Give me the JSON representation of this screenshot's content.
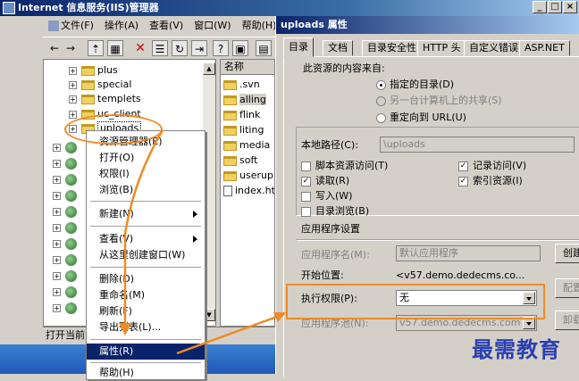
{
  "main_window": {
    "title": "Internet 信息服务(IIS)管理器",
    "controls": {
      "minimize": "_",
      "maximize": "□",
      "close": "×"
    }
  },
  "menubar": [
    "文件(F)",
    "操作(A)",
    "查看(V)",
    "窗口(W)",
    "帮助(H)"
  ],
  "toolbar_glyphs": {
    "back": "←",
    "forward": "→",
    "up": "⇡",
    "view": "▦",
    "delete": "✕",
    "properties": "☰",
    "refresh": "↻",
    "export": "⇥",
    "help": "?",
    "console": "▣",
    "extra": "▤"
  },
  "tree": {
    "items": [
      {
        "label": "plus",
        "kind": "folder"
      },
      {
        "label": "special",
        "kind": "folder"
      },
      {
        "label": "templets",
        "kind": "folder"
      },
      {
        "label": "uc_client",
        "kind": "folder"
      },
      {
        "label": "uploads",
        "kind": "folder",
        "selected": true
      }
    ],
    "site_count": 12
  },
  "list": {
    "header": "名称",
    "items": [
      {
        "label": ".svn",
        "kind": "folder"
      },
      {
        "label": "alling",
        "kind": "folder",
        "selected": true
      },
      {
        "label": "flink",
        "kind": "folder"
      },
      {
        "label": "liting",
        "kind": "folder"
      },
      {
        "label": "media",
        "kind": "folder"
      },
      {
        "label": "soft",
        "kind": "folder"
      },
      {
        "label": "userup",
        "kind": "folder"
      },
      {
        "label": "index.ht",
        "kind": "file"
      }
    ]
  },
  "status_text": "打开当前",
  "context_menu": {
    "items": [
      {
        "label": "资源管理器(E)"
      },
      {
        "label": "打开(O)"
      },
      {
        "label": "权限(I)"
      },
      {
        "label": "浏览(B)"
      },
      {
        "sep": true
      },
      {
        "label": "新建(N)",
        "submenu": true
      },
      {
        "sep": true
      },
      {
        "label": "查看(V)",
        "submenu": true
      },
      {
        "label": "从这里创建窗口(W)"
      },
      {
        "sep": true
      },
      {
        "label": "删除(D)"
      },
      {
        "label": "重命名(M)"
      },
      {
        "label": "刷新(F)"
      },
      {
        "label": "导出列表(L)..."
      },
      {
        "sep": true
      },
      {
        "label": "属性(R)",
        "highlighted": true
      },
      {
        "sep": true
      },
      {
        "label": "帮助(H)"
      }
    ]
  },
  "dialog": {
    "title": "uploads 属性",
    "tabs": [
      "目录",
      "文档",
      "目录安全性",
      "HTTP 头",
      "自定义错误",
      "ASP.NET"
    ],
    "active_tab": 0,
    "content_source": {
      "label": "此资源的内容来自:",
      "options": [
        {
          "label": "指定的目录(D)",
          "checked": true,
          "enabled": true
        },
        {
          "label": "另一台计算机上的共享(S)",
          "checked": false,
          "enabled": false
        },
        {
          "label": "重定向到 URL(U)",
          "checked": false,
          "enabled": true
        }
      ]
    },
    "local_path": {
      "label": "本地路径(C):",
      "value": "\\uploads"
    },
    "checkboxes_left": [
      {
        "label": "脚本资源访问(T)",
        "checked": false
      },
      {
        "label": "读取(R)",
        "checked": true
      },
      {
        "label": "写入(W)",
        "checked": false
      },
      {
        "label": "目录浏览(B)",
        "checked": false
      }
    ],
    "checkboxes_right": [
      {
        "label": "记录访问(V)",
        "checked": true
      },
      {
        "label": "索引资源(I)",
        "checked": true
      }
    ],
    "app_settings": {
      "label": "应用程序设置",
      "app_name_label": "应用程序名(M):",
      "app_name_value": "默认应用程序",
      "start_point_label": "开始位置:",
      "start_point_value": "<v57.demo.dedecms.co...",
      "exec_perm_label": "执行权限(P):",
      "exec_perm_value": "无",
      "app_pool_label": "应用程序池(N):",
      "app_pool_value": "v57.demo.dedecms.com",
      "create_button": "创建",
      "config_button": "配置",
      "unload_button": "卸载"
    }
  },
  "watermark": "最需教育",
  "colors": {
    "annotation": "#f08a24",
    "selection": "#0a246a",
    "watermark": "#2a3fb0"
  }
}
